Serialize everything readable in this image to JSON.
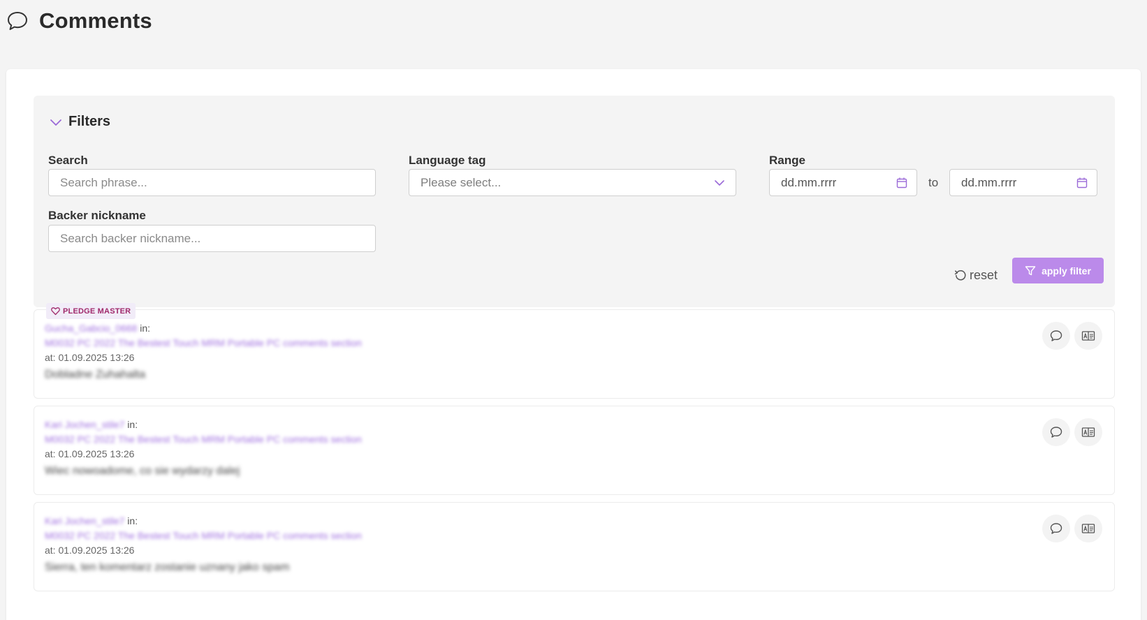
{
  "page": {
    "title": "Comments",
    "icon": "comment-icon"
  },
  "filters": {
    "title": "Filters",
    "search": {
      "label": "Search",
      "placeholder": "Search phrase..."
    },
    "language_tag": {
      "label": "Language tag",
      "placeholder": "Please select..."
    },
    "range": {
      "label": "Range",
      "from_placeholder": "dd.mm.rrrr",
      "separator": "to",
      "to_placeholder": "dd.mm.rrrr"
    },
    "backer_nickname": {
      "label": "Backer nickname",
      "placeholder": "Search backer nickname..."
    },
    "reset_label": "reset",
    "apply_label": "apply filter"
  },
  "colors": {
    "accent": "#bb8aea",
    "badge_text": "#a02a6b",
    "badge_bg": "#f1ecf8"
  },
  "comments": [
    {
      "badge": "PLEDGE MASTER",
      "author": "Gucha_Gabcio_0668",
      "in_label": "in:",
      "link": "M0032 PC 2022 The Bestest Touch MRM Portable PC comments section",
      "date": "at: 01.09.2025 13:26",
      "text": "Dobladne Zuhahalta"
    },
    {
      "author": "Kari Jochen_stile7",
      "in_label": "in:",
      "link": "M0032 PC 2022 The Bestest Touch MRM Portable PC comments section",
      "date": "at: 01.09.2025 13:26",
      "text": "Wiec nowoadome, co sie wydarzy dalej"
    },
    {
      "author": "Kari Jochen_stile7",
      "in_label": "in:",
      "link": "M0032 PC 2022 The Bestest Touch MRM Portable PC comments section",
      "date": "at: 01.09.2025 13:26",
      "text": "Sierra, ten komentarz zostanie uznany jako spam"
    }
  ]
}
